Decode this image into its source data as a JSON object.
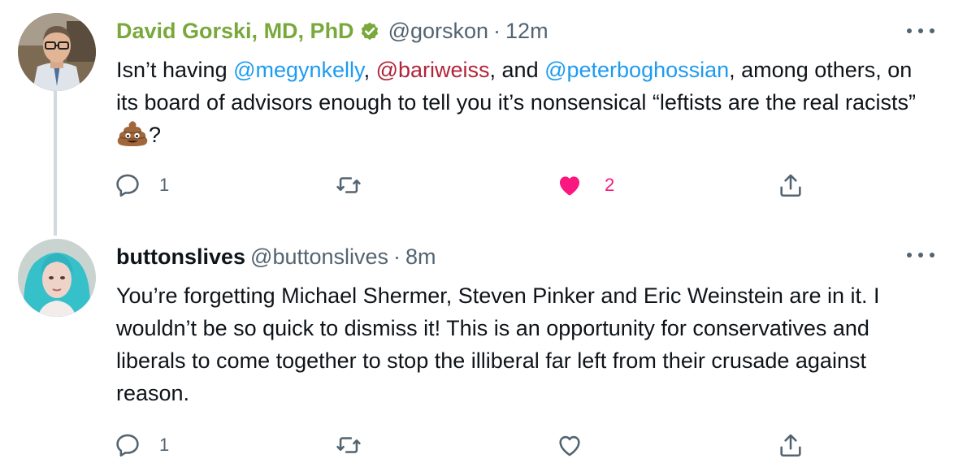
{
  "tweets": [
    {
      "author": {
        "display_name": "David Gorski, MD, PhD",
        "handle": "@gorskon",
        "verified": true,
        "avatar": "person-with-glasses"
      },
      "separator": "·",
      "time": "12m",
      "text": {
        "part1": "Isn’t having ",
        "mention1": "@megynkelly",
        "part2": ", ",
        "mention2": "@bariweiss",
        "part3": ", and ",
        "mention3": "@peterboghossian",
        "part4": ", among others, on its board of advisors enough to tell you it’s nonsensical “leftists are the real racists” ",
        "emoji": "pile-of-poo",
        "part5": "?"
      },
      "actions": {
        "reply_count": "1",
        "retweet_count": "",
        "like_count": "2",
        "liked": true
      }
    },
    {
      "author": {
        "display_name": "buttonslives",
        "handle": "@buttonslives",
        "verified": false,
        "avatar": "person-with-teal-hair"
      },
      "separator": "·",
      "time": "8m",
      "text": {
        "body": "You’re forgetting Michael Shermer, Steven Pinker and Eric Weinstein are in it. I wouldn’t be so quick to dismiss it! This is an opportunity for conservatives and liberals to come together to stop the illiberal far left from their crusade against reason."
      },
      "actions": {
        "reply_count": "1",
        "retweet_count": "",
        "like_count": "",
        "liked": false
      }
    }
  ],
  "colors": {
    "accent_name_green": "#79a83b",
    "mention_blue": "#1d9bf0",
    "mention_red": "#b0243a",
    "like_pink": "#f91880",
    "muted": "#536471"
  }
}
